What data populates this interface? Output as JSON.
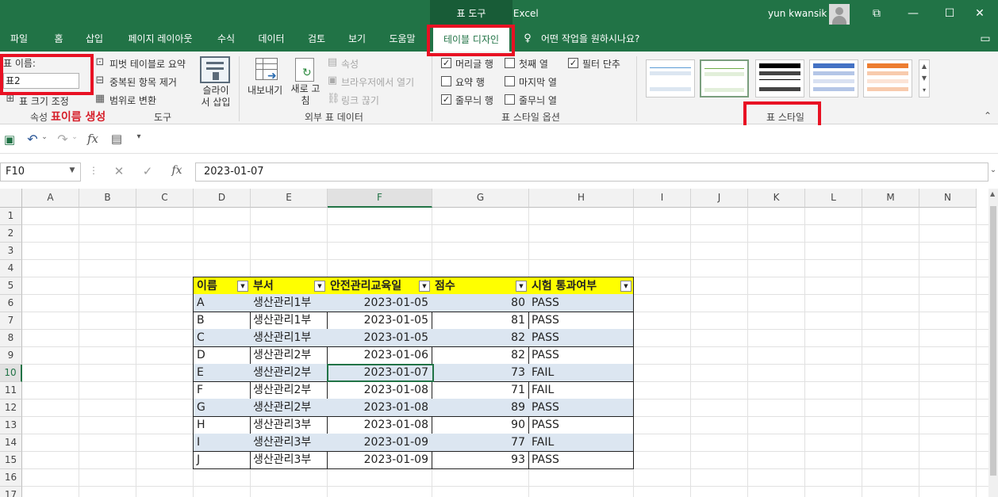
{
  "window": {
    "title": "통합 문서1  -  Excel",
    "context_group": "표 도구",
    "user": "yun kwansik",
    "minimize": "—",
    "restore": "☐",
    "close": "✕",
    "ribbon_display": "⧉"
  },
  "tabs": [
    "파일",
    "홈",
    "삽입",
    "페이지 레이아웃",
    "수식",
    "데이터",
    "검토",
    "보기",
    "도움말",
    "테이블 디자인"
  ],
  "tell_me": "어떤 작업을 원하시나요?",
  "ribbon": {
    "props": {
      "name_label": "표 이름:",
      "name_value": "표2",
      "resize": "표 크기 조정",
      "group_label": "속성",
      "annotation": "표이름 생성"
    },
    "tools": {
      "pivot": "피벗 테이블로 요약",
      "remove_dup": "중복된 항목 제거",
      "convert": "범위로 변환",
      "slicer": "슬라이서 삽입",
      "group_label": "도구"
    },
    "external": {
      "export": "내보내기",
      "refresh": "새로 고침",
      "properties": "속성",
      "open_browser": "브라우저에서 열기",
      "unlink": "링크 끊기",
      "group_label": "외부 표 데이터"
    },
    "options": {
      "header_row": "머리글 행",
      "total_row": "요약 행",
      "banded_rows": "줄무늬 행",
      "first_col": "첫째 열",
      "last_col": "마지막 열",
      "banded_cols": "줄무늬 열",
      "filter_btn": "필터 단추",
      "group_label": "표 스타일 옵션"
    },
    "styles": {
      "group_label": "표 스타일"
    }
  },
  "formula_bar": {
    "name_box": "F10",
    "value": "2023-01-07"
  },
  "columns": [
    "A",
    "B",
    "C",
    "D",
    "E",
    "F",
    "G",
    "H",
    "I",
    "J",
    "K",
    "L",
    "M",
    "N"
  ],
  "rows": [
    "1",
    "2",
    "3",
    "4",
    "5",
    "6",
    "7",
    "8",
    "9",
    "10",
    "11",
    "12",
    "13",
    "14",
    "15",
    "16",
    "17"
  ],
  "table": {
    "headers": [
      "이름",
      "부서",
      "안전관리교육일",
      "점수",
      "시험 통과여부"
    ],
    "rows": [
      [
        "A",
        "생산관리1부",
        "2023-01-05",
        "80",
        "PASS"
      ],
      [
        "B",
        "생산관리1부",
        "2023-01-05",
        "81",
        "PASS"
      ],
      [
        "C",
        "생산관리1부",
        "2023-01-05",
        "82",
        "PASS"
      ],
      [
        "D",
        "생산관리2부",
        "2023-01-06",
        "82",
        "PASS"
      ],
      [
        "E",
        "생산관리2부",
        "2023-01-07",
        "73",
        "FAIL"
      ],
      [
        "F",
        "생산관리2부",
        "2023-01-08",
        "71",
        "FAIL"
      ],
      [
        "G",
        "생산관리2부",
        "2023-01-08",
        "89",
        "PASS"
      ],
      [
        "H",
        "생산관리3부",
        "2023-01-08",
        "90",
        "PASS"
      ],
      [
        "I",
        "생산관리3부",
        "2023-01-09",
        "77",
        "FAIL"
      ],
      [
        "J",
        "생산관리3부",
        "2023-01-09",
        "93",
        "PASS"
      ]
    ]
  },
  "colors": {
    "excel_green": "#217346",
    "highlight_red": "#e81123",
    "header_yellow": "#ffff00",
    "band_blue": "#dce6f1"
  }
}
